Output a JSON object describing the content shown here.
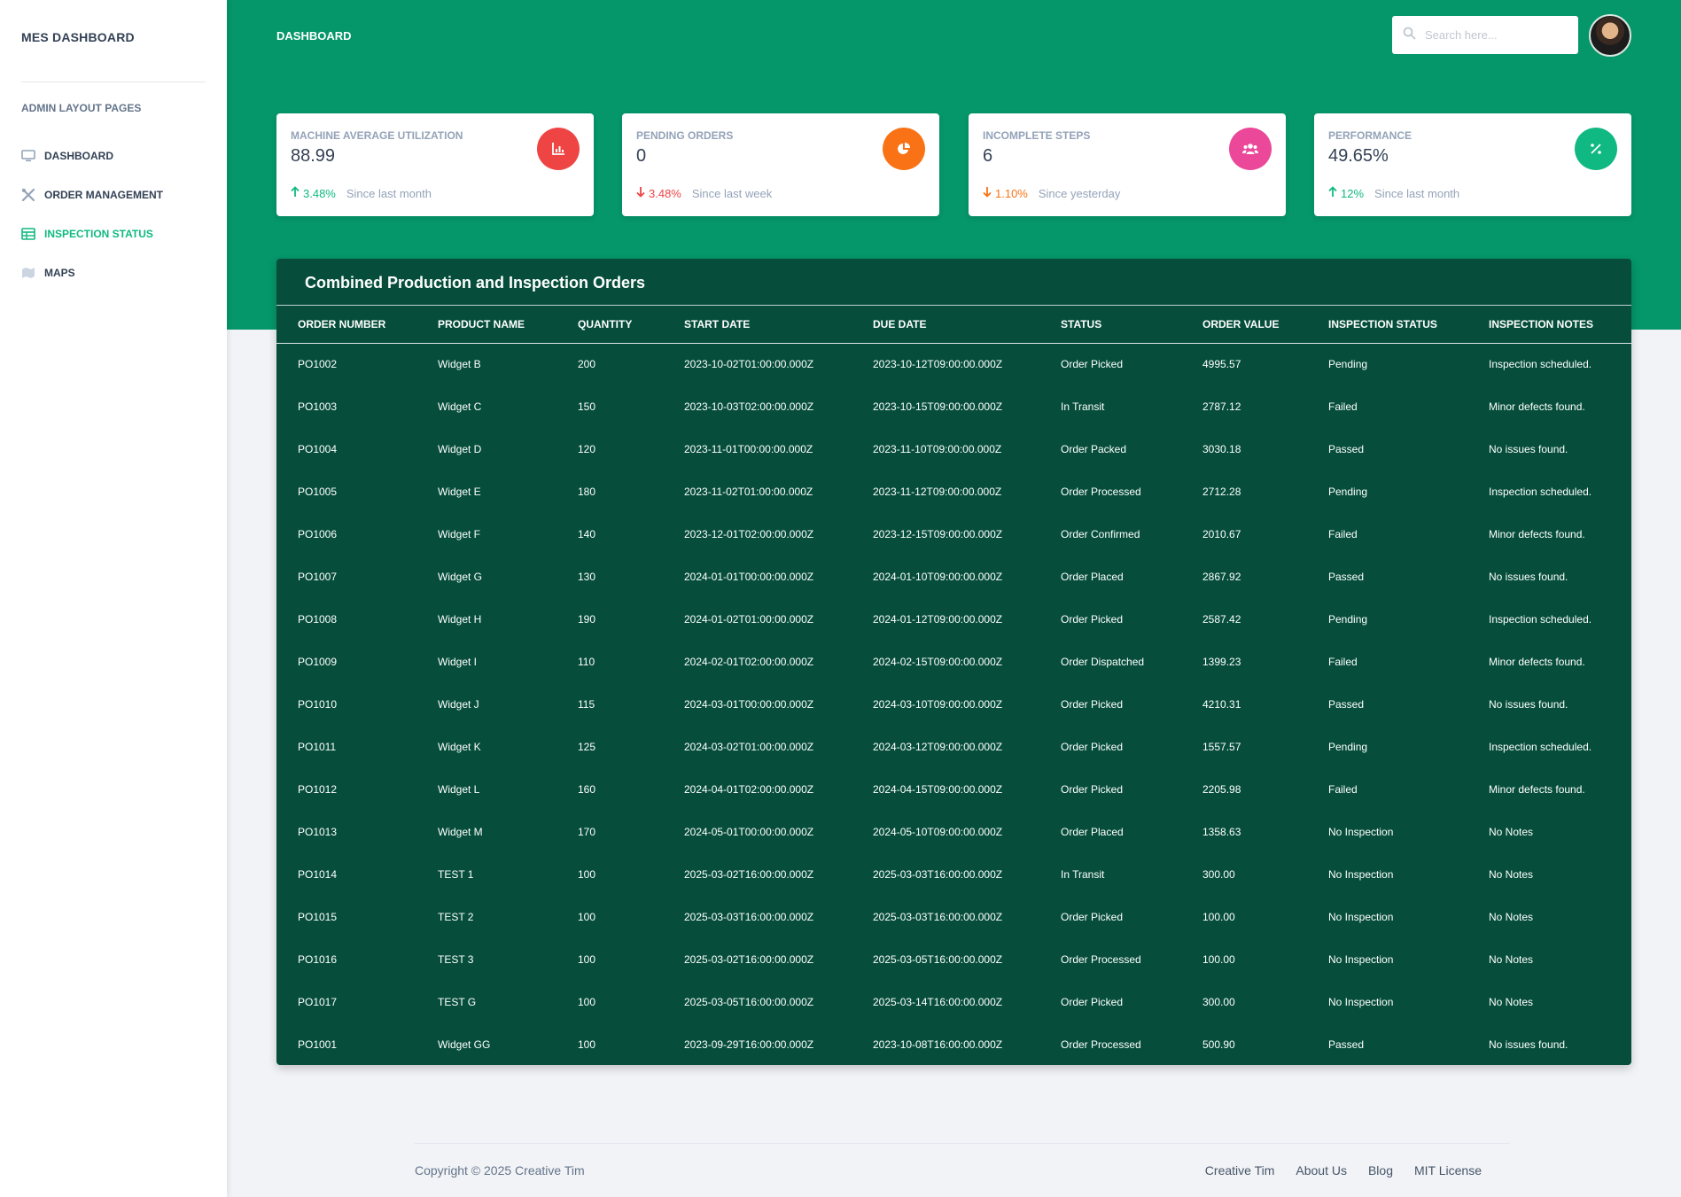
{
  "sidebar": {
    "brand": "MES DASHBOARD",
    "section_heading": "ADMIN LAYOUT PAGES",
    "items": [
      {
        "label": "DASHBOARD",
        "icon": "monitor-icon"
      },
      {
        "label": "ORDER MANAGEMENT",
        "icon": "tools-icon"
      },
      {
        "label": "INSPECTION STATUS",
        "icon": "table-icon",
        "active": true
      },
      {
        "label": "MAPS",
        "icon": "map-icon"
      }
    ]
  },
  "header": {
    "title": "DASHBOARD",
    "search_placeholder": "Search here..."
  },
  "stats": [
    {
      "label": "MACHINE AVERAGE UTILIZATION",
      "value": "88.99",
      "change": "3.48%",
      "direction": "up",
      "change_color": "#10b981",
      "since": "Since last month",
      "icon": "bar-chart-icon",
      "icon_bg": "#ef4444"
    },
    {
      "label": "PENDING ORDERS",
      "value": "0",
      "change": "3.48%",
      "direction": "down",
      "change_color": "#ef4444",
      "since": "Since last week",
      "icon": "pie-chart-icon",
      "icon_bg": "#f97316"
    },
    {
      "label": "INCOMPLETE STEPS",
      "value": "6",
      "change": "1.10%",
      "direction": "down",
      "change_color": "#f97316",
      "since": "Since yesterday",
      "icon": "users-icon",
      "icon_bg": "#ec4899"
    },
    {
      "label": "PERFORMANCE",
      "value": "49.65%",
      "change": "12%",
      "direction": "up",
      "change_color": "#10b981",
      "since": "Since last month",
      "icon": "percent-icon",
      "icon_bg": "#10b981"
    }
  ],
  "orders_table": {
    "title": "Combined Production and Inspection Orders",
    "columns": [
      "ORDER NUMBER",
      "PRODUCT NAME",
      "QUANTITY",
      "START DATE",
      "DUE DATE",
      "STATUS",
      "ORDER VALUE",
      "INSPECTION STATUS",
      "INSPECTION NOTES"
    ],
    "rows": [
      [
        "PO1002",
        "Widget B",
        "200",
        "2023-10-02T01:00:00.000Z",
        "2023-10-12T09:00:00.000Z",
        "Order Picked",
        "4995.57",
        "Pending",
        "Inspection scheduled."
      ],
      [
        "PO1003",
        "Widget C",
        "150",
        "2023-10-03T02:00:00.000Z",
        "2023-10-15T09:00:00.000Z",
        "In Transit",
        "2787.12",
        "Failed",
        "Minor defects found."
      ],
      [
        "PO1004",
        "Widget D",
        "120",
        "2023-11-01T00:00:00.000Z",
        "2023-11-10T09:00:00.000Z",
        "Order Packed",
        "3030.18",
        "Passed",
        "No issues found."
      ],
      [
        "PO1005",
        "Widget E",
        "180",
        "2023-11-02T01:00:00.000Z",
        "2023-11-12T09:00:00.000Z",
        "Order Processed",
        "2712.28",
        "Pending",
        "Inspection scheduled."
      ],
      [
        "PO1006",
        "Widget F",
        "140",
        "2023-12-01T02:00:00.000Z",
        "2023-12-15T09:00:00.000Z",
        "Order Confirmed",
        "2010.67",
        "Failed",
        "Minor defects found."
      ],
      [
        "PO1007",
        "Widget G",
        "130",
        "2024-01-01T00:00:00.000Z",
        "2024-01-10T09:00:00.000Z",
        "Order Placed",
        "2867.92",
        "Passed",
        "No issues found."
      ],
      [
        "PO1008",
        "Widget H",
        "190",
        "2024-01-02T01:00:00.000Z",
        "2024-01-12T09:00:00.000Z",
        "Order Picked",
        "2587.42",
        "Pending",
        "Inspection scheduled."
      ],
      [
        "PO1009",
        "Widget I",
        "110",
        "2024-02-01T02:00:00.000Z",
        "2024-02-15T09:00:00.000Z",
        "Order Dispatched",
        "1399.23",
        "Failed",
        "Minor defects found."
      ],
      [
        "PO1010",
        "Widget J",
        "115",
        "2024-03-01T00:00:00.000Z",
        "2024-03-10T09:00:00.000Z",
        "Order Picked",
        "4210.31",
        "Passed",
        "No issues found."
      ],
      [
        "PO1011",
        "Widget K",
        "125",
        "2024-03-02T01:00:00.000Z",
        "2024-03-12T09:00:00.000Z",
        "Order Picked",
        "1557.57",
        "Pending",
        "Inspection scheduled."
      ],
      [
        "PO1012",
        "Widget L",
        "160",
        "2024-04-01T02:00:00.000Z",
        "2024-04-15T09:00:00.000Z",
        "Order Picked",
        "2205.98",
        "Failed",
        "Minor defects found."
      ],
      [
        "PO1013",
        "Widget M",
        "170",
        "2024-05-01T00:00:00.000Z",
        "2024-05-10T09:00:00.000Z",
        "Order Placed",
        "1358.63",
        "No Inspection",
        "No Notes"
      ],
      [
        "PO1014",
        "TEST 1",
        "100",
        "2025-03-02T16:00:00.000Z",
        "2025-03-03T16:00:00.000Z",
        "In Transit",
        "300.00",
        "No Inspection",
        "No Notes"
      ],
      [
        "PO1015",
        "TEST 2",
        "100",
        "2025-03-03T16:00:00.000Z",
        "2025-03-03T16:00:00.000Z",
        "Order Picked",
        "100.00",
        "No Inspection",
        "No Notes"
      ],
      [
        "PO1016",
        "TEST 3",
        "100",
        "2025-03-02T16:00:00.000Z",
        "2025-03-05T16:00:00.000Z",
        "Order Processed",
        "100.00",
        "No Inspection",
        "No Notes"
      ],
      [
        "PO1017",
        "TEST G",
        "100",
        "2025-03-05T16:00:00.000Z",
        "2025-03-14T16:00:00.000Z",
        "Order Picked",
        "300.00",
        "No Inspection",
        "No Notes"
      ],
      [
        "PO1001",
        "Widget GG",
        "100",
        "2023-09-29T16:00:00.000Z",
        "2023-10-08T16:00:00.000Z",
        "Order Processed",
        "500.90",
        "Passed",
        "No issues found."
      ]
    ]
  },
  "footer": {
    "copyright": "Copyright © 2025 Creative Tim",
    "links": [
      "Creative Tim",
      "About Us",
      "Blog",
      "MIT License"
    ]
  },
  "colors": {
    "brand_green": "#059669",
    "table_bg": "#064e3b",
    "active_nav": "#10b981"
  }
}
